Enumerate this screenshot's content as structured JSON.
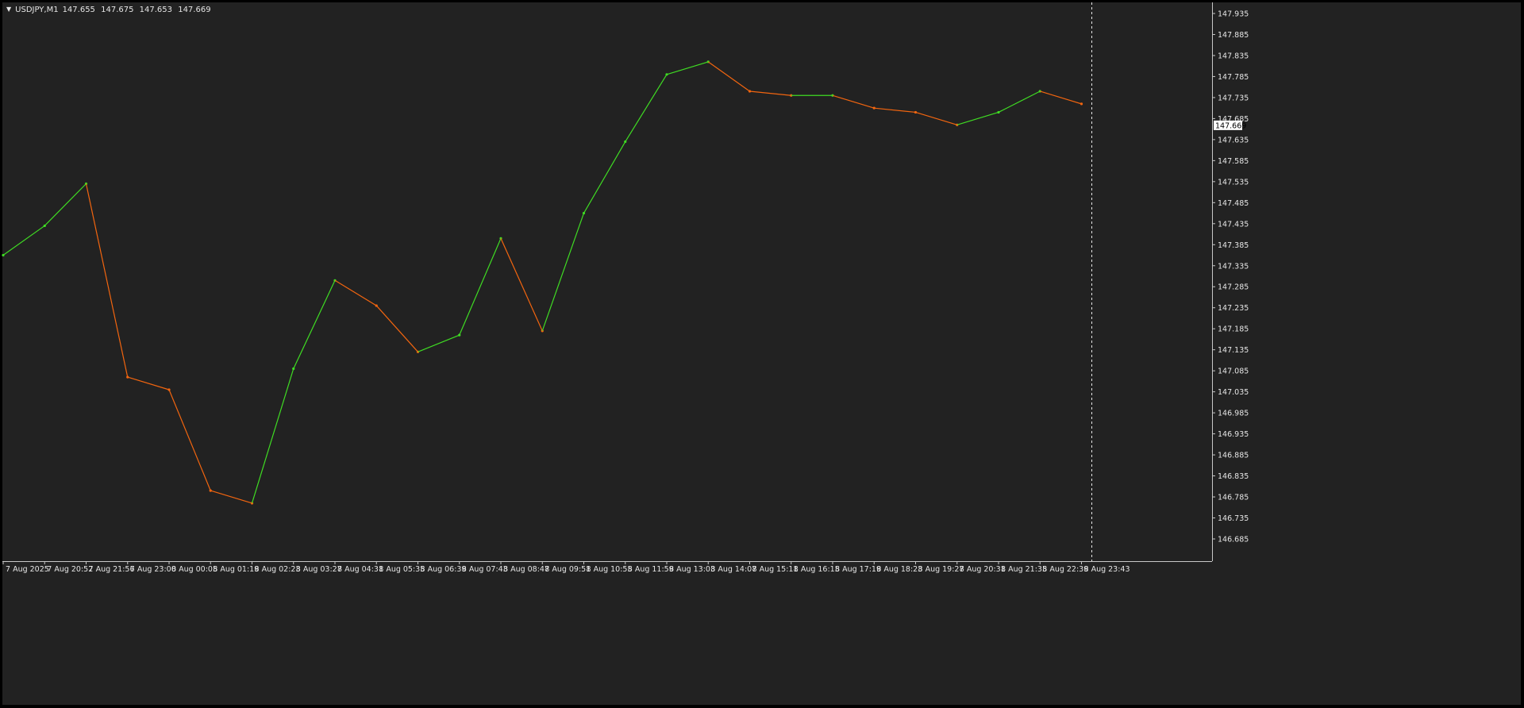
{
  "window": {
    "symbol": "USDJPY,M1",
    "ohlc": {
      "open": "147.655",
      "high": "147.675",
      "low": "147.653",
      "close": "147.669"
    }
  },
  "colors": {
    "background": "#222222",
    "frame": "#000000",
    "axis_border": "#c8c8c8",
    "text": "#e6e6e6",
    "bull_candle": "#3fdc23",
    "bear_candle": "#f2650f",
    "price_label_bg": "#ffffff",
    "price_label_text": "#000000",
    "period_separator": "#e6e6e6"
  },
  "chart_data": {
    "type": "line",
    "instrument": "USDJPY",
    "timeframe": "M1",
    "current_price": "147.669",
    "price_axis": {
      "ticks": [
        "147.935",
        "147.885",
        "147.835",
        "147.785",
        "147.735",
        "147.685",
        "147.635",
        "147.585",
        "147.535",
        "147.485",
        "147.435",
        "147.385",
        "147.335",
        "147.285",
        "147.235",
        "147.185",
        "147.135",
        "147.085",
        "147.035",
        "146.985",
        "146.935",
        "146.885",
        "146.835",
        "146.785",
        "146.735",
        "146.685"
      ],
      "ylim": [
        146.685,
        147.935
      ],
      "scale": "linear"
    },
    "time_axis": {
      "ticks": [
        "7 Aug 2025",
        "7 Aug 20:52",
        "7 Aug 21:56",
        "7 Aug 23:00",
        "8 Aug 00:05",
        "8 Aug 01:19",
        "8 Aug 02:23",
        "8 Aug 03:27",
        "8 Aug 04:31",
        "8 Aug 05:35",
        "8 Aug 06:39",
        "8 Aug 07:43",
        "8 Aug 08:47",
        "8 Aug 09:51",
        "8 Aug 10:55",
        "8 Aug 11:59",
        "8 Aug 13:03",
        "8 Aug 14:07",
        "8 Aug 15:11",
        "8 Aug 16:15",
        "8 Aug 17:19",
        "8 Aug 18:23",
        "8 Aug 19:27",
        "8 Aug 20:31",
        "8 Aug 21:35",
        "8 Aug 22:39",
        "8 Aug 23:43"
      ]
    },
    "series": [
      {
        "x": [
          "7 Aug 2025",
          "7 Aug 20:52",
          "7 Aug 21:56",
          "7 Aug 23:00",
          "8 Aug 00:05",
          "8 Aug 01:19",
          "8 Aug 02:23",
          "8 Aug 03:27",
          "8 Aug 04:31",
          "8 Aug 05:35",
          "8 Aug 06:39",
          "8 Aug 07:43",
          "8 Aug 08:47",
          "8 Aug 09:51",
          "8 Aug 10:55",
          "8 Aug 11:59",
          "8 Aug 13:03",
          "8 Aug 14:07",
          "8 Aug 15:11",
          "8 Aug 16:15",
          "8 Aug 17:19",
          "8 Aug 18:23",
          "8 Aug 19:27",
          "8 Aug 20:31",
          "8 Aug 21:35",
          "8 Aug 22:39",
          "8 Aug 23:43"
        ],
        "values": [
          147.36,
          147.43,
          147.53,
          147.07,
          147.04,
          146.8,
          146.77,
          147.09,
          147.3,
          147.24,
          147.13,
          147.17,
          147.4,
          147.18,
          147.46,
          147.63,
          147.79,
          147.82,
          147.75,
          147.74,
          147.74,
          147.71,
          147.7,
          147.67,
          147.7,
          147.75,
          147.72
        ]
      }
    ],
    "grid": false,
    "period_separator_at": "8 Aug 23:43"
  }
}
